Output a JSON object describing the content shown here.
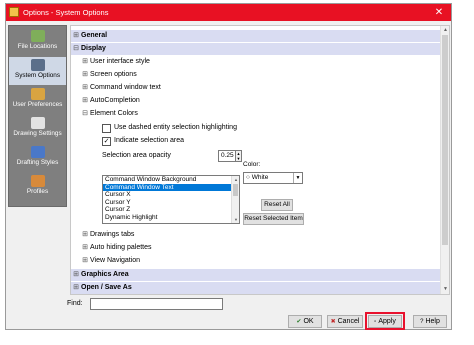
{
  "window": {
    "title": "Options - System Options",
    "close_glyph": "✕"
  },
  "sidebar": {
    "items": [
      {
        "label": "File Locations",
        "icon": "file-locations-icon"
      },
      {
        "label": "System Options",
        "icon": "system-options-icon"
      },
      {
        "label": "User Preferences",
        "icon": "user-preferences-icon"
      },
      {
        "label": "Drawing Settings",
        "icon": "drawing-settings-icon"
      },
      {
        "label": "Drafting Styles",
        "icon": "drafting-styles-icon"
      },
      {
        "label": "Profiles",
        "icon": "profiles-icon"
      }
    ],
    "selected": "System Options"
  },
  "tree": {
    "general": {
      "label": "General",
      "glyph": "⊞"
    },
    "display": {
      "label": "Display",
      "glyph": "⊟"
    },
    "display_children": {
      "user_interface": {
        "label": "User interface style",
        "glyph": "⊞"
      },
      "screen_options": {
        "label": "Screen options",
        "glyph": "⊞"
      },
      "command_window_text": {
        "label": "Command window text",
        "glyph": "⊞"
      },
      "autocompletion": {
        "label": "AutoCompletion",
        "glyph": "⊞"
      },
      "element_colors": {
        "label": "Element Colors",
        "glyph": "⊟"
      },
      "drawings_tabs": {
        "label": "Drawings tabs",
        "glyph": "⊞"
      },
      "auto_hiding": {
        "label": "Auto hiding palettes",
        "glyph": "⊞"
      },
      "view_navigation": {
        "label": "View Navigation",
        "glyph": "⊞"
      }
    },
    "graphics_area": {
      "label": "Graphics Area",
      "glyph": "⊞"
    },
    "open_save": {
      "label": "Open / Save As",
      "glyph": "⊞"
    }
  },
  "element_colors": {
    "dashed_highlight": {
      "label": "Use dashed entity selection highlighting",
      "checked": false
    },
    "indicate_area": {
      "label": "Indicate selection area",
      "checked": true,
      "glyph": "✓"
    },
    "opacity_label": "Selection area opacity",
    "opacity_value": "0.25",
    "spin_up": "▲",
    "spin_down": "▼",
    "list_items": [
      "Command Window Background",
      "Command Window Text",
      "Cursor X",
      "Cursor Y",
      "Cursor Z",
      "Dynamic Highlight"
    ],
    "selected_item": "Command Window Text",
    "color_label": "Color:",
    "color_value": "○ White",
    "dropdown_arrow": "▼",
    "reset_all": "Reset All",
    "reset_selected": "Reset Selected Item"
  },
  "find": {
    "label": "Find:",
    "value": ""
  },
  "footer": {
    "ok": {
      "label": "OK",
      "glyph": "✔"
    },
    "cancel": {
      "label": "Cancel",
      "glyph": "✖"
    },
    "apply": {
      "label": "Apply",
      "glyph": "▫"
    },
    "help": {
      "label": "Help",
      "glyph": "?"
    }
  },
  "colors": {
    "titlebar": "#e81123",
    "section_header": "#d9dcf2",
    "sidebar": "#7f7f7f",
    "selection": "#0078d7",
    "apply_highlight": "#e8112d"
  }
}
